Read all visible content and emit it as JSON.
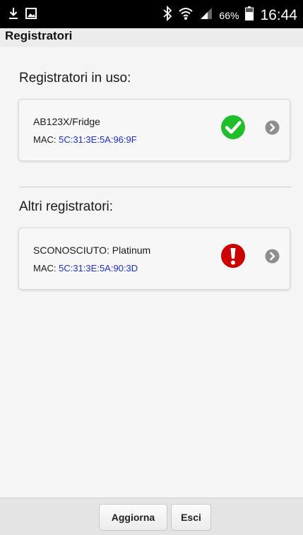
{
  "status_bar": {
    "battery_percent": "66%",
    "time": "16:44",
    "icons": [
      "download-icon",
      "image-icon",
      "bluetooth-icon",
      "wifi-icon",
      "signal-icon",
      "battery-icon"
    ]
  },
  "header": {
    "title": "Registratori"
  },
  "sections": {
    "in_use": {
      "title": "Registratori in uso:",
      "device": {
        "name": "AB123X/Fridge",
        "mac_label": "MAC: ",
        "mac_value": "5C:31:3E:5A:96:9F",
        "status_icon": "check-circle-icon",
        "status_color": "#1fbe2a"
      }
    },
    "other": {
      "title": "Altri registratori:",
      "device": {
        "name": "SCONOSCIUTO: Platinum",
        "mac_label": "MAC: ",
        "mac_value": "5C:31:3E:5A:90:3D",
        "status_icon": "alert-circle-icon",
        "status_color": "#cc0000"
      }
    }
  },
  "footer": {
    "refresh_label": "Aggiorna",
    "exit_label": "Esci"
  },
  "colors": {
    "mac_text": "#1a2fd1",
    "chevron": "#8e8e8e"
  }
}
